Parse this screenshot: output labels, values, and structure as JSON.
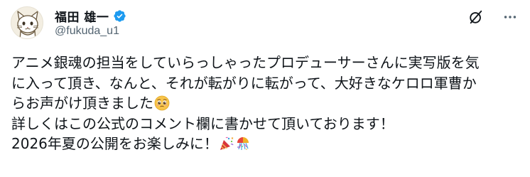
{
  "author": {
    "display_name": "福田 雄一",
    "handle": "@fukuda_u1",
    "verified": true,
    "avatar_icon": "cat-illustration-avatar"
  },
  "actions": {
    "grok_icon": "grok-icon",
    "more_icon": "more-options-icon"
  },
  "post": {
    "lines": [
      "アニメ銀魂の担当をしていらっしゃったプロデューサーさんに実写版を気",
      "に入って頂き、なんと、それが転がりに転がって、大好きなケロロ軍曹か",
      "らお声がけ頂きました",
      "詳しくはこの公式のコメント欄に書かせて頂いております！",
      "2026年夏の公開をお楽しみに！"
    ],
    "emojis": {
      "line3": "pleading-face-emoji",
      "line5": [
        "party-popper-emoji",
        "confetti-ball-emoji"
      ]
    }
  },
  "colors": {
    "verified_blue": "#1d9bf0",
    "text_primary": "#0f1419",
    "text_secondary": "#536471"
  }
}
